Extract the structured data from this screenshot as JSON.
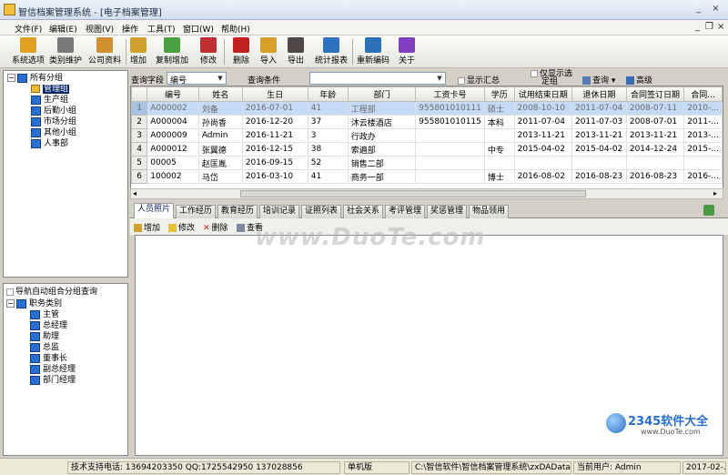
{
  "window": {
    "title": "智信档案管理系统 - [电子档案管理]",
    "min": "_",
    "close": "×"
  },
  "menu": [
    "文件(F)",
    "编辑(E)",
    "视图(V)",
    "操作",
    "工具(T)",
    "窗口(W)",
    "帮助(H)"
  ],
  "mdi": {
    "min": "_",
    "restore": "❐",
    "close": "×"
  },
  "toolbar": [
    {
      "label": "系统选项",
      "icon": "system-options-icon",
      "color": "#e0a020"
    },
    {
      "label": "类别维护",
      "icon": "tools-icon",
      "color": "#7a7a7a"
    },
    {
      "label": "公司资料",
      "icon": "company-icon",
      "color": "#d09030"
    },
    {
      "label": "增加",
      "icon": "add-icon",
      "color": "#d0a030"
    },
    {
      "label": "复制增加",
      "icon": "copy-add-icon",
      "color": "#4aa040"
    },
    {
      "label": "修改",
      "icon": "edit-icon",
      "color": "#c03030"
    },
    {
      "label": "删除",
      "icon": "delete-icon",
      "color": "#c02020"
    },
    {
      "label": "导入",
      "icon": "import-icon",
      "color": "#d8a028"
    },
    {
      "label": "导出",
      "icon": "export-icon",
      "color": "#504848"
    },
    {
      "label": "统计报表",
      "icon": "report-icon",
      "color": "#3070c0"
    },
    {
      "label": "重新编码",
      "icon": "recode-icon",
      "color": "#2d6fb8"
    },
    {
      "label": "关于",
      "icon": "help-icon",
      "color": "#8040c0"
    }
  ],
  "tree1": {
    "root": "所有分组",
    "items": [
      "管理组",
      "生产组",
      "后勤小组",
      "市场分组",
      "其他小组",
      "人事部"
    ]
  },
  "tree2": {
    "header": "导航自动组合分组查询",
    "root": "职务类别",
    "items": [
      "主管",
      "总经理",
      "助理",
      "总监",
      "董事长",
      "副总经理",
      "部门经理"
    ]
  },
  "query": {
    "field_label": "查询字段",
    "field_value": "编号",
    "cond_label": "查询条件",
    "cond_value": "",
    "summary": "显示汇总",
    "only_selected": "仅显示选",
    "only_selected2": "定组",
    "search": "查询",
    "advanced": "高级"
  },
  "grid": {
    "columns": [
      "编号",
      "姓名",
      "生日",
      "年龄",
      "部门",
      "工资卡号",
      "学历",
      "试用结束日期",
      "退休日期",
      "合同签订日期",
      "合同..."
    ],
    "rows": [
      [
        "1",
        "A000002",
        "刘备",
        "2016-07-01",
        "41",
        "工程部",
        "955801010111",
        "硕士",
        "2008-10-10",
        "2011-07-04",
        "2008-07-11",
        "2010-..."
      ],
      [
        "2",
        "A000004",
        "孙尚香",
        "2016-12-20",
        "37",
        "沐云楼酒店",
        "955801010115",
        "本科",
        "2011-07-04",
        "2011-07-03",
        "2008-07-01",
        "2011-..."
      ],
      [
        "3",
        "A000009",
        "Admin",
        "2016-11-21",
        "3",
        "行政办",
        "",
        "",
        "2013-11-21",
        "2013-11-21",
        "2013-11-21",
        "2013-..."
      ],
      [
        "4",
        "A000012",
        "张翼德",
        "2016-12-15",
        "38",
        "索遍部",
        "",
        "中专",
        "2015-04-02",
        "2015-04-02",
        "2014-12-24",
        "2015-..."
      ],
      [
        "5",
        "00005",
        "赵匡胤",
        "2016-09-15",
        "52",
        "销售二部",
        "",
        "",
        "",
        "",
        "",
        ""
      ],
      [
        "6",
        "100002",
        "马岱",
        "2016-03-10",
        "41",
        "商务一部",
        "",
        "博士",
        "2016-08-02",
        "2016-08-23",
        "2016-08-23",
        "2016-..."
      ]
    ]
  },
  "tabs": [
    "人员照片",
    "工作经历",
    "教育经历",
    "培训记录",
    "证照列表",
    "社会关系",
    "考评管理",
    "奖惩管理",
    "物品领用"
  ],
  "subtoolbar": {
    "add": "增加",
    "edit": "修改",
    "delete": "删除",
    "view": "查看"
  },
  "watermark": "www.DuoTe.com",
  "status": {
    "support": "技术支持电话: 13694203350 QQ:1725542950 137028856",
    "mode": "单机版",
    "path": "C:\\智信软件\\智信档案管理系统\\zxDAData.sys",
    "user": "当前用户: Admin",
    "date": "2017-02-..."
  },
  "logo": {
    "name": "2345软件大全",
    "url": "www.DuoTe.com"
  }
}
